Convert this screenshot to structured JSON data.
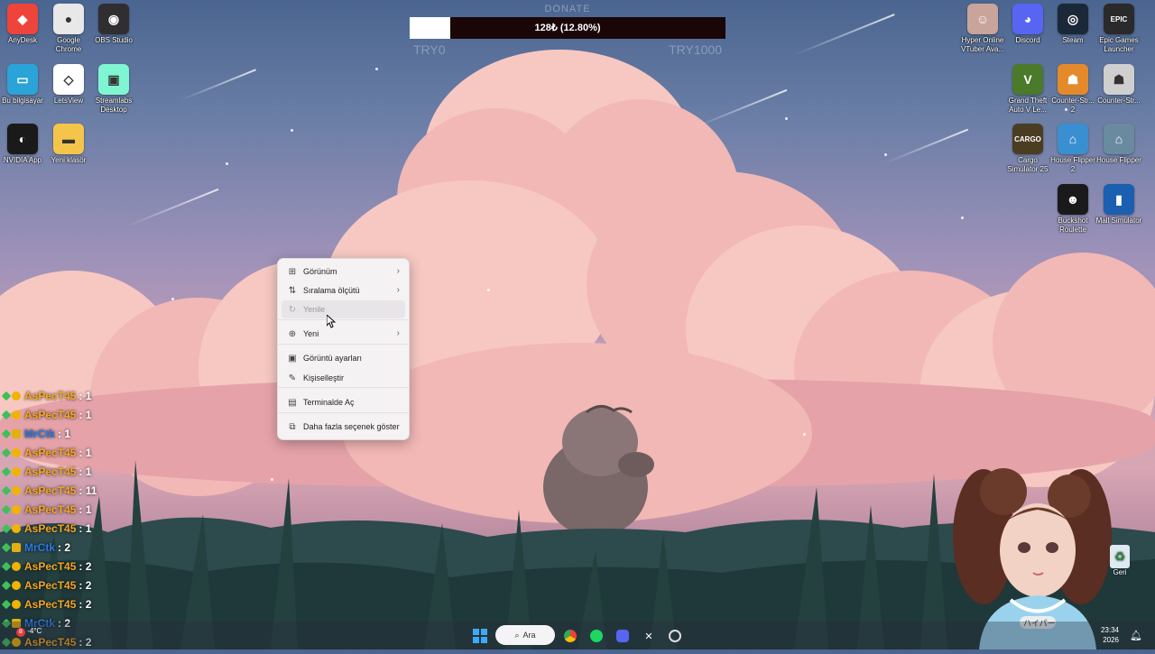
{
  "donate": {
    "title": "DONATE",
    "progress_text": "128₺ (12.80%)",
    "progress_fraction": 0.128,
    "min_label": "TRY0",
    "max_label": "TRY1000"
  },
  "desktop_left": [
    {
      "label": "AnyDesk",
      "icon": "anydesk-icon",
      "color": "#ef443b",
      "glyph": "◆"
    },
    {
      "label": "Google Chrome",
      "icon": "chrome-icon",
      "color": "#e8e8e8",
      "glyph": "●"
    },
    {
      "label": "OBS Studio",
      "icon": "obs-icon",
      "color": "#302e31",
      "glyph": "◉"
    },
    {
      "label": "Bu bilgisayar",
      "icon": "computer-icon",
      "color": "#2aa3d8",
      "glyph": "▭"
    },
    {
      "label": "LetsView",
      "icon": "letsview-icon",
      "color": "#ffffff",
      "glyph": "◇"
    },
    {
      "label": "Streamlabs Desktop",
      "icon": "streamlabs-icon",
      "color": "#80f5d2",
      "glyph": "▣"
    },
    {
      "label": "NVIDIA App",
      "icon": "nvidia-icon",
      "color": "#1a1a1a",
      "glyph": "◐"
    },
    {
      "label": "Yeni klasör",
      "icon": "folder-icon",
      "color": "#f4c54a",
      "glyph": "▬"
    }
  ],
  "desktop_right": [
    {
      "label": "Hyper Online VTuber Ava...",
      "icon": "vtuber-avatar-icon",
      "color": "#c9a49a",
      "glyph": "☺"
    },
    {
      "label": "Discord",
      "icon": "discord-icon",
      "color": "#5865f2",
      "glyph": "◕"
    },
    {
      "label": "Steam",
      "icon": "steam-icon",
      "color": "#1b2838",
      "glyph": "◎"
    },
    {
      "label": "Epic Games Launcher",
      "icon": "epic-games-icon",
      "color": "#2a2a2a",
      "glyph": "EPIC"
    },
    {
      "label": "Grand Theft Auto V Le...",
      "icon": "gta-icon",
      "color": "#4a7a2a",
      "glyph": "V"
    },
    {
      "label": "Counter-Str... 2",
      "icon": "counter-strike-icon",
      "color": "#e58a2a",
      "glyph": "☗"
    },
    {
      "label": "Counter-Str...",
      "icon": "counter-strike-icon",
      "color": "#cfcfcf",
      "glyph": "☗"
    },
    {
      "label": "Cargo Simulator 25",
      "icon": "cargo-simulator-icon",
      "color": "#4a3d22",
      "glyph": "CARGO"
    },
    {
      "label": "House Flipper 2",
      "icon": "house-flipper-icon",
      "color": "#3a8fd0",
      "glyph": "⌂"
    },
    {
      "label": "House Flipper",
      "icon": "house-flipper-icon",
      "color": "#6a8aa0",
      "glyph": "⌂"
    },
    {
      "label": "Buckshot Roulette",
      "icon": "buckshot-roulette-icon",
      "color": "#1a1a1a",
      "glyph": "☻"
    },
    {
      "label": "Mall Simulator",
      "icon": "mall-simulator-icon",
      "color": "#1a5fb0",
      "glyph": "▮"
    }
  ],
  "context_menu": [
    {
      "label": "Görünüm",
      "icon": "grid-icon",
      "glyph": "⊞",
      "submenu": true
    },
    {
      "label": "Sıralama ölçütü",
      "icon": "sort-icon",
      "glyph": "⇅",
      "submenu": true
    },
    {
      "label": "Yenile",
      "icon": "refresh-icon",
      "glyph": "↻",
      "submenu": false,
      "disabled": true
    },
    {
      "label": "Yeni",
      "icon": "new-plus-icon",
      "glyph": "⊕",
      "submenu": true
    },
    {
      "label": "Görüntü ayarları",
      "icon": "display-icon",
      "glyph": "▣",
      "submenu": false
    },
    {
      "label": "Kişiselleştir",
      "icon": "brush-icon",
      "glyph": "✎",
      "submenu": false
    },
    {
      "label": "Terminalde Aç",
      "icon": "terminal-icon",
      "glyph": "▤",
      "submenu": false
    },
    {
      "label": "Daha fazla seçenek göster",
      "icon": "more-options-icon",
      "glyph": "⧉",
      "submenu": false
    }
  ],
  "chat": [
    {
      "name": "AsPecT45",
      "count": ": 1",
      "color": "#f5a623"
    },
    {
      "name": "AsPecT45",
      "count": ": 1",
      "color": "#f5a623"
    },
    {
      "name": "MrCtk",
      "count": ": 1",
      "color": "#2a7be4"
    },
    {
      "name": "AsPecT45",
      "count": ": 1",
      "color": "#f5a623"
    },
    {
      "name": "AsPecT45",
      "count": ": 1",
      "color": "#f5a623"
    },
    {
      "name": "AsPecT45",
      "count": ": 11",
      "color": "#f5a623"
    },
    {
      "name": "AsPecT45",
      "count": ": 1",
      "color": "#f5a623"
    },
    {
      "name": "AsPecT45",
      "count": ": 1",
      "color": "#f5a623"
    },
    {
      "name": "MrCtk",
      "count": ": 2",
      "color": "#2a7be4"
    },
    {
      "name": "AsPecT45",
      "count": ": 2",
      "color": "#f5a623"
    },
    {
      "name": "AsPecT45",
      "count": ": 2",
      "color": "#f5a623"
    },
    {
      "name": "AsPecT45",
      "count": ": 2",
      "color": "#f5a623"
    },
    {
      "name": "MrCtk",
      "count": ": 2",
      "color": "#2a7be4"
    },
    {
      "name": "AsPecT45",
      "count": ": 2",
      "color": "#f5a623"
    }
  ],
  "taskbar": {
    "search_label": "Ara",
    "weather": "-4°C",
    "weather_badge": "8",
    "time": "23:34",
    "date": "2026"
  },
  "recycle_bin": {
    "label": "Geri"
  },
  "avatar": {
    "shirt_text": "ハイパー"
  }
}
